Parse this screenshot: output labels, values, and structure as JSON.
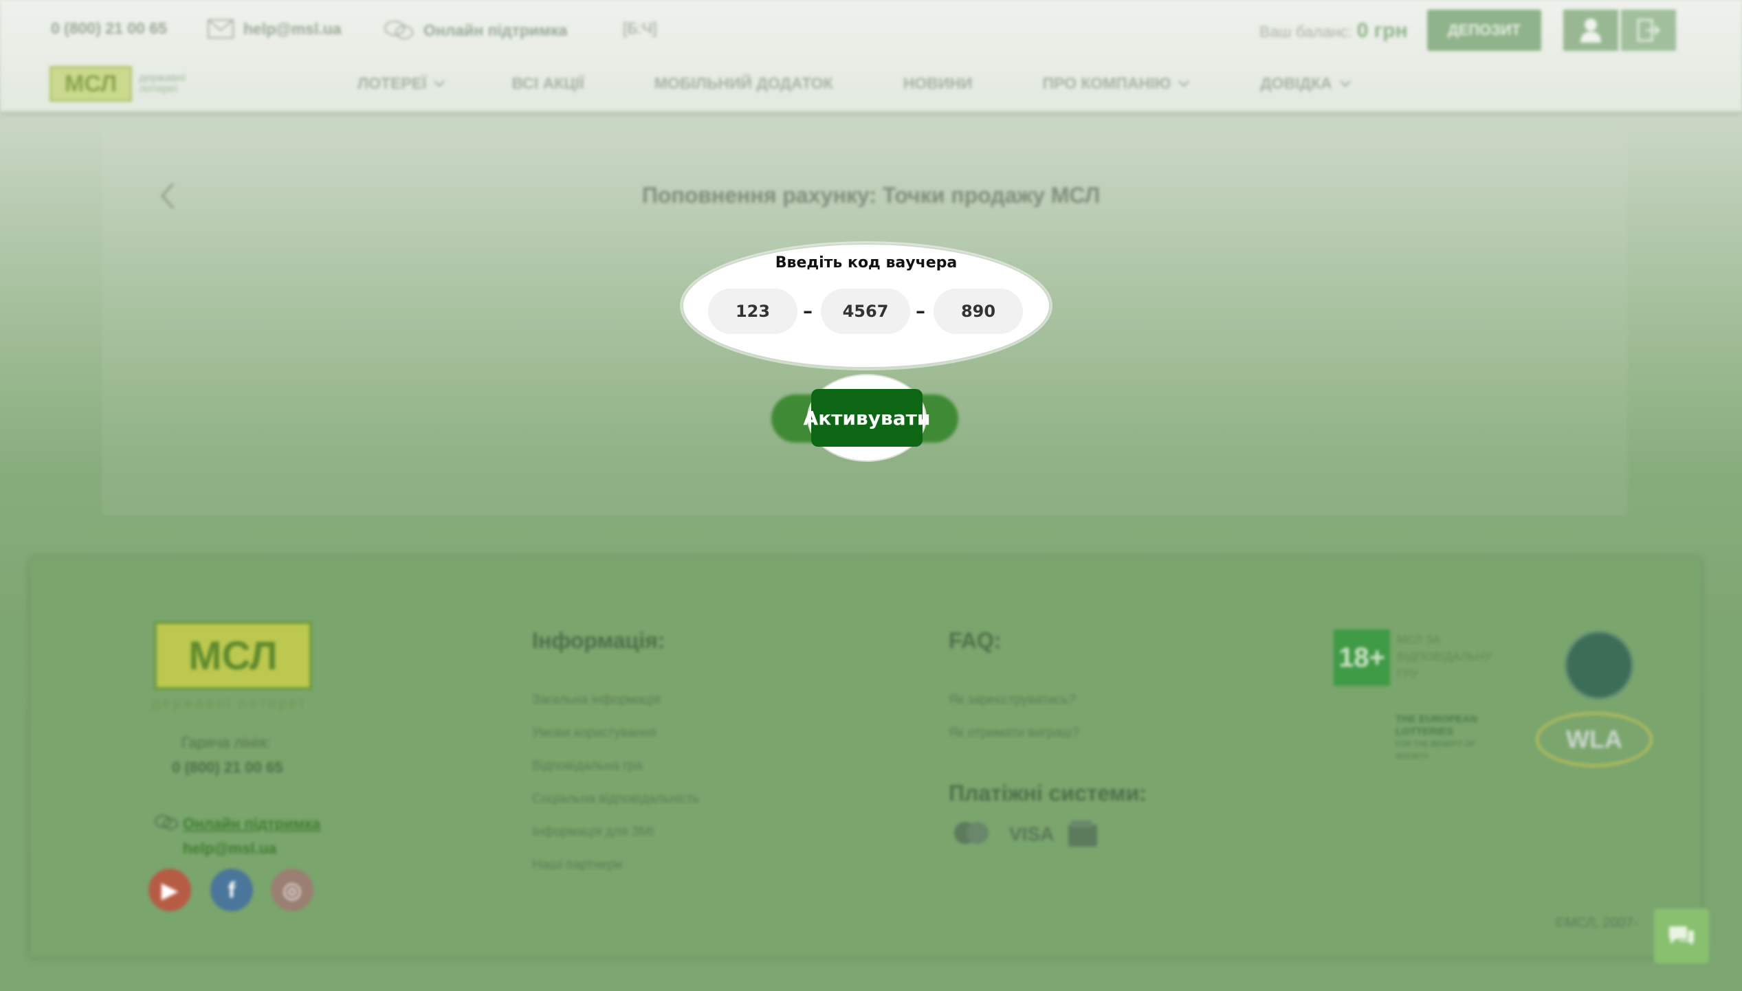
{
  "header": {
    "phone": "0 (800) 21 00 65",
    "email": "help@msl.ua",
    "support": "Онлайн підтримка",
    "accessibility": "[Б:Ч]",
    "balance_label": "Ваш баланс:",
    "balance_value": "0 грн",
    "deposit_label": "ДЕПОЗИТ"
  },
  "logo": {
    "text": "МСЛ",
    "sub_line1": "державні",
    "sub_line2": "лотереї"
  },
  "nav": [
    {
      "label": "ЛОТЕРЕЇ",
      "dropdown": true
    },
    {
      "label": "ВСІ АКЦІЇ",
      "dropdown": false
    },
    {
      "label": "МОБІЛЬНИЙ ДОДАТОК",
      "dropdown": false
    },
    {
      "label": "НОВИНИ",
      "dropdown": false
    },
    {
      "label": "ПРО КОМПАНІЮ",
      "dropdown": true
    },
    {
      "label": "ДОВІДКА",
      "dropdown": true
    }
  ],
  "page": {
    "title": "Поповнення рахунку: Точки продажу МСЛ",
    "voucher_label": "Введіть код ваучера",
    "voucher_parts": [
      "123",
      "4567",
      "890"
    ],
    "separator": "–",
    "activate_label": "Активувати"
  },
  "footer": {
    "logo_text": "МСЛ",
    "logo_sub": "державні лотереї",
    "hotline_label": "Гаряча лінія:",
    "hotline_number": "0 (800) 21 00 65",
    "support_link": "Онлайн підтримка",
    "email_link": "help@msl.ua",
    "info_heading": "Інформація:",
    "info_links": [
      "Загальна інформація",
      "Умови користування",
      "Відповідальна гра",
      "Соціальна відповідальність",
      "Інформація для ЗМІ",
      "Наші партнери"
    ],
    "faq_heading": "FAQ:",
    "faq_links": [
      "Як зареєструватись?",
      "Як отримати виграш?"
    ],
    "payments_heading": "Платіжні системи:",
    "payment_visa": "VISA",
    "badge18": "18+",
    "badge18_text": "МСЛ ЗА ВІДПОВІДАЛЬНУ ГРУ",
    "eu_line1": "THE EUROPEAN",
    "eu_line2": "LOTTERIES",
    "eu_line3": "FOR THE BENEFIT OF SOCIETY",
    "wla": "WLA",
    "copyright": "©МСЛ, 2007-"
  },
  "colors": {
    "accent_green": "#0d6614",
    "brand_green": "#8fb38a"
  }
}
